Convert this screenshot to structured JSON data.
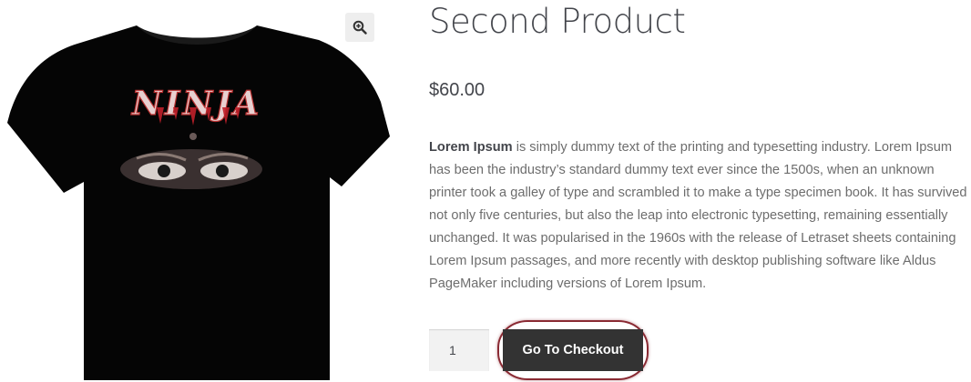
{
  "product": {
    "title": "Second Product",
    "price": "$60.00",
    "image": {
      "alt": "Black t-shirt with NINJA print",
      "print_text": "NINJA"
    },
    "zoom_icon": "magnifier-plus-icon",
    "description_lead": "Lorem Ipsum",
    "description_rest": " is simply dummy text of the printing and typesetting industry. Lorem Ipsum has been the industry’s standard dummy text ever since the 1500s, when an unknown printer took a galley of type and scrambled it to make a type specimen book. It has survived not only five centuries, but also the leap into electronic typesetting, remaining essentially unchanged. It was popularised in the 1960s with the release of Letraset sheets containing Lorem Ipsum passages, and more recently with desktop publishing software like Aldus PageMaker including versions of Lorem Ipsum."
  },
  "cart": {
    "quantity": "1",
    "checkout_label": "Go To Checkout"
  },
  "colors": {
    "button_bg": "#333333",
    "highlight_ring": "#8a2a33",
    "text": "#43454b",
    "muted_text": "#6d6d6d"
  }
}
